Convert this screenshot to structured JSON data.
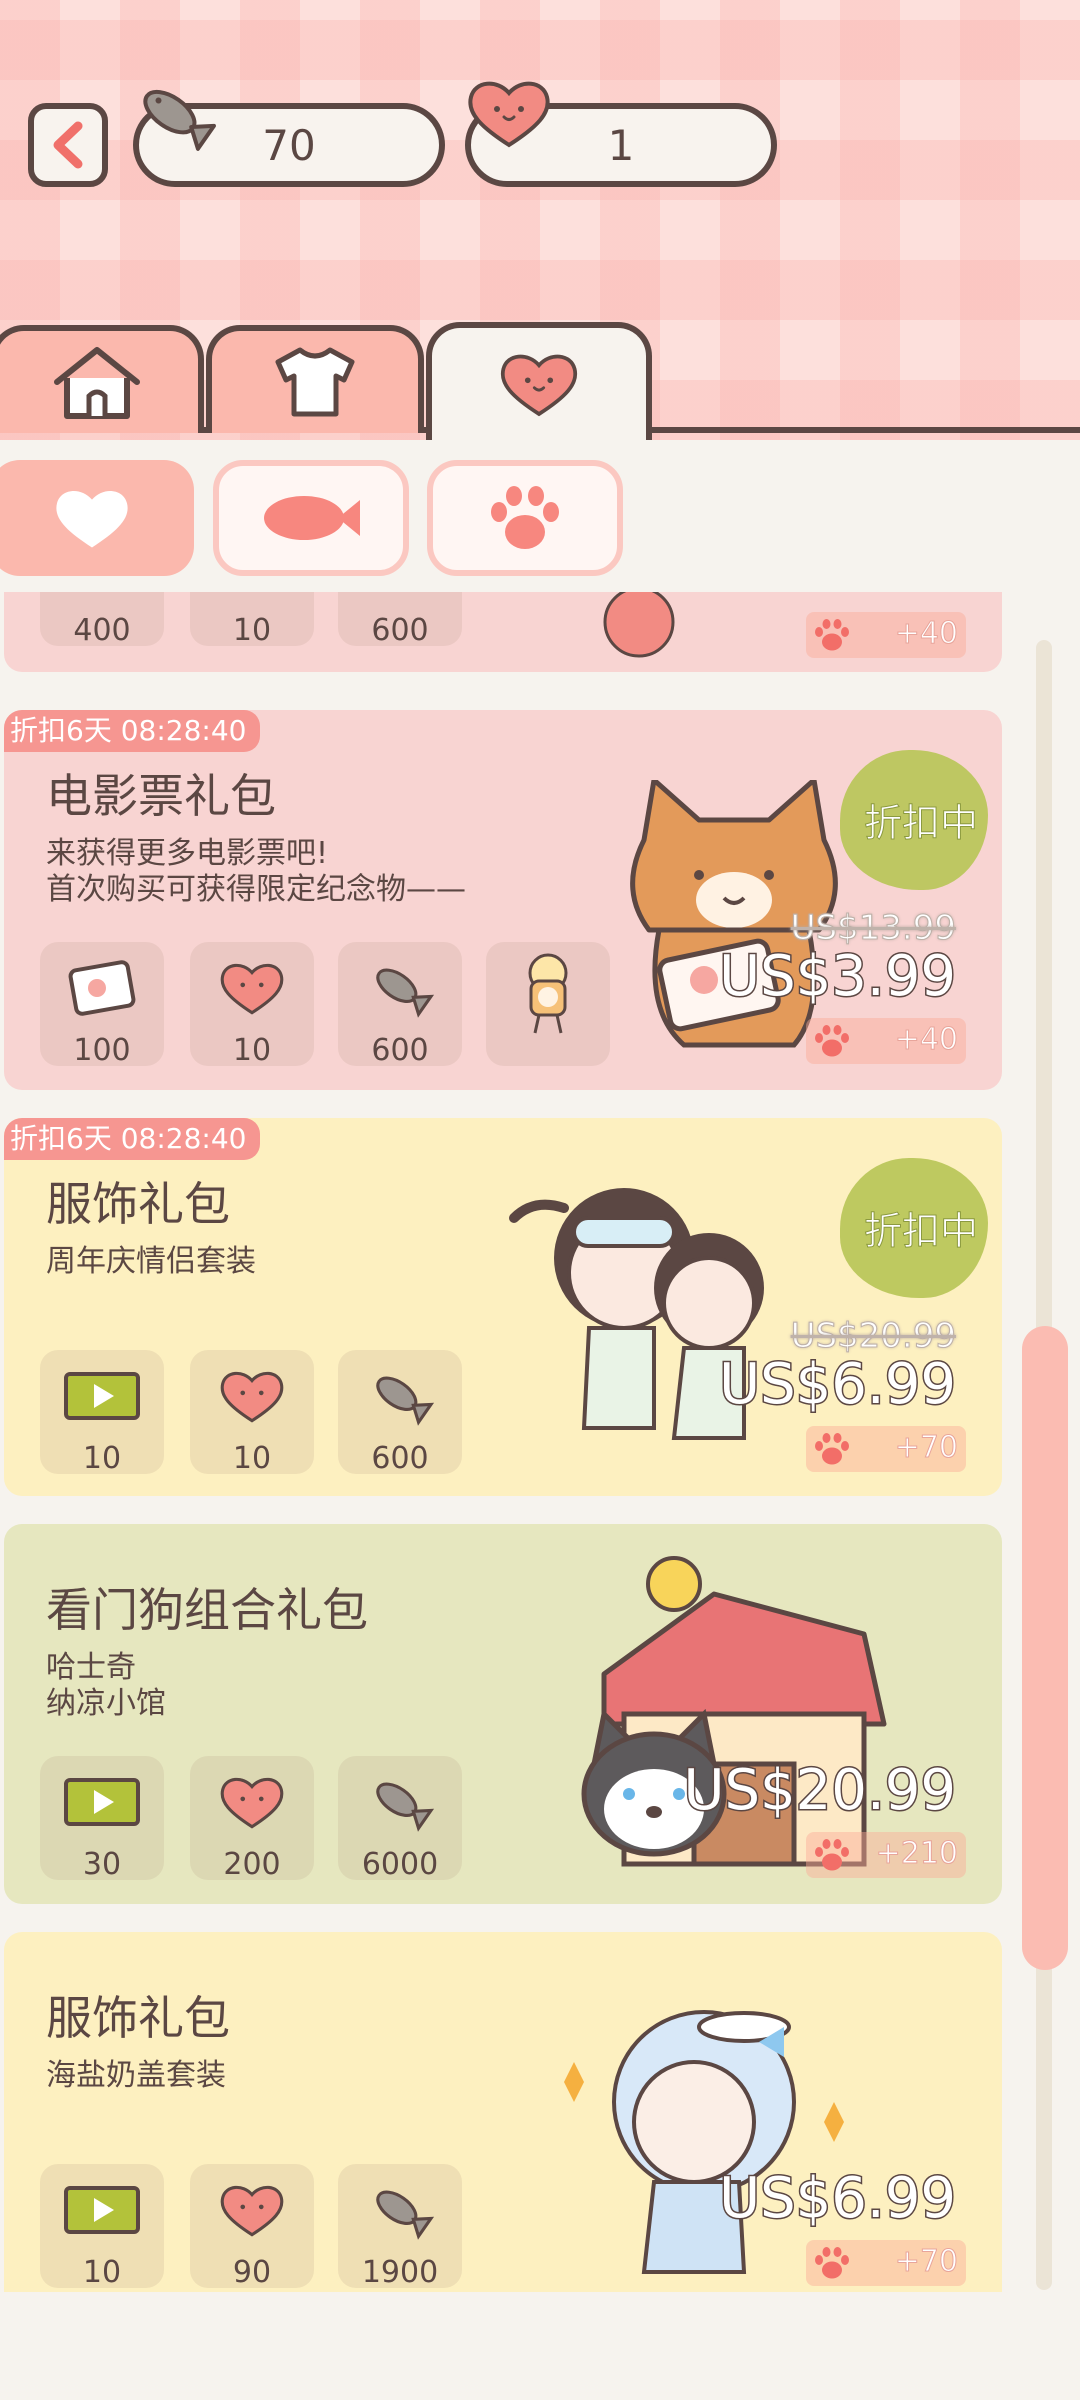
{
  "header": {
    "fish_count": "70",
    "heart_count": "1",
    "icons": [
      "back-arrow-icon",
      "fish-icon",
      "heart-icon"
    ]
  },
  "tabs": {
    "items": [
      {
        "icon": "house-icon"
      },
      {
        "icon": "shirt-icon"
      },
      {
        "icon": "heart-face-icon",
        "selected": true
      }
    ]
  },
  "subtabs": {
    "items": [
      {
        "icon": "heart-icon",
        "selected": true
      },
      {
        "icon": "fish-icon"
      },
      {
        "icon": "paw-icon"
      }
    ]
  },
  "partial_card": {
    "items": [
      {
        "icon": "flower-icon",
        "value": "400"
      },
      {
        "icon": "heart-icon",
        "value": "10"
      },
      {
        "icon": "fish-icon",
        "value": "600"
      }
    ],
    "bonus": "+40"
  },
  "cards": [
    {
      "badge": "折扣6天 08:28:40",
      "title": "电影票礼包",
      "desc_line1": "来获得更多电影票吧!",
      "desc_line2": "首次购买可获得限定纪念物——",
      "discount": "折扣中",
      "old_price": "US$13.99",
      "price": "US$3.99",
      "bonus": "+40",
      "items": [
        {
          "icon": "ticket-icon",
          "value": "100"
        },
        {
          "icon": "heart-icon",
          "value": "10"
        },
        {
          "icon": "fish-icon",
          "value": "600"
        },
        {
          "icon": "popcorn-figure-icon",
          "value": ""
        }
      ]
    },
    {
      "badge": "折扣6天 08:28:40",
      "title": "服饰礼包",
      "desc_line1": "周年庆情侣套装",
      "discount": "折扣中",
      "old_price": "US$20.99",
      "price": "US$6.99",
      "bonus": "+70",
      "items": [
        {
          "icon": "green-ticket-icon",
          "value": "10"
        },
        {
          "icon": "heart-icon",
          "value": "10"
        },
        {
          "icon": "fish-icon",
          "value": "600"
        }
      ]
    },
    {
      "title": "看门狗组合礼包",
      "desc_line1": "哈士奇",
      "desc_line2": "纳凉小馆",
      "price": "US$20.99",
      "bonus": "+210",
      "items": [
        {
          "icon": "green-ticket-icon",
          "value": "30"
        },
        {
          "icon": "heart-icon",
          "value": "200"
        },
        {
          "icon": "fish-icon",
          "value": "6000"
        }
      ]
    },
    {
      "title": "服饰礼包",
      "desc_line1": "海盐奶盖套装",
      "price": "US$6.99",
      "bonus": "+70",
      "items": [
        {
          "icon": "green-ticket-icon",
          "value": "10"
        },
        {
          "icon": "heart-icon",
          "value": "90"
        },
        {
          "icon": "fish-icon",
          "value": "1900"
        }
      ]
    }
  ],
  "colors": {
    "outline": "#5b4743",
    "pink": "#fbb8ad",
    "card_pink": "#f8d4d2",
    "card_yellow": "#fdf0c0",
    "card_green": "#e6e7bf",
    "discount_green": "#b9c658"
  }
}
